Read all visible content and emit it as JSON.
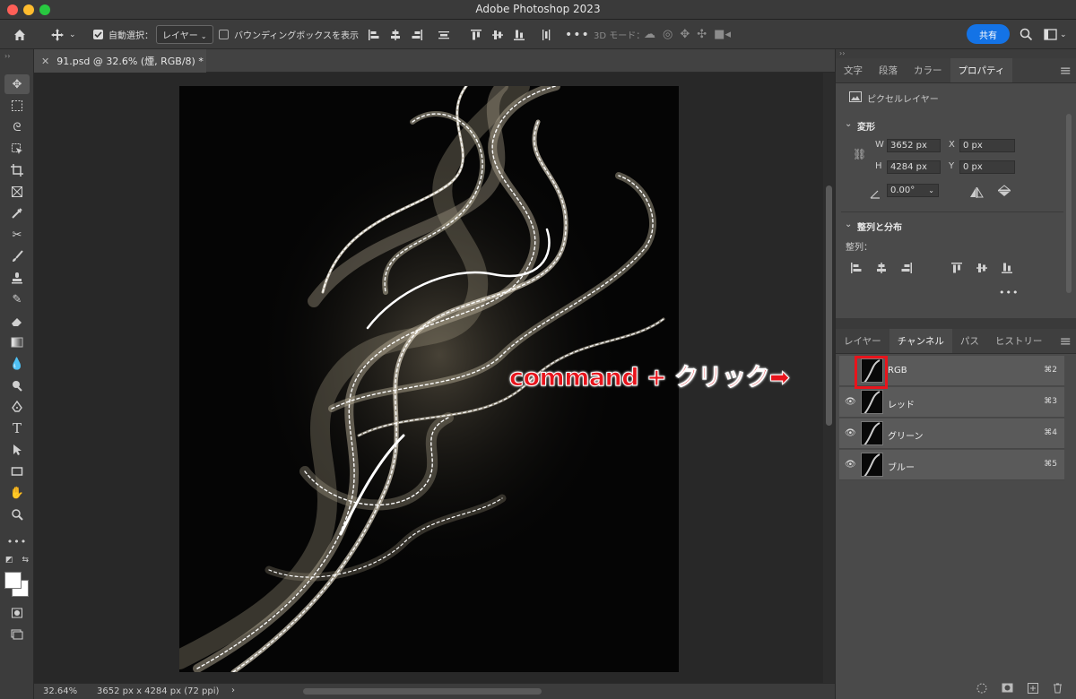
{
  "window": {
    "title": "Adobe Photoshop 2023"
  },
  "options_bar": {
    "auto_select_label": "自動選択：",
    "auto_select_value": "レイヤー",
    "bounding_box_label": "バウンディングボックスを表示",
    "mode_3d_label": "3D モード：",
    "share_label": "共有"
  },
  "document": {
    "tab_title": "91.psd @ 32.6% (煙, RGB/8) *"
  },
  "status_bar": {
    "zoom": "32.64%",
    "doc_info": "3652 px x 4284 px (72 ppi)"
  },
  "top_panel": {
    "tabs": [
      "文字",
      "段落",
      "カラー",
      "プロパティ"
    ],
    "active_tab": 3,
    "layer_kind": "ピクセルレイヤー",
    "transform_section": "変形",
    "w_label": "W",
    "w_value": "3652 px",
    "h_label": "H",
    "h_value": "4284 px",
    "x_label": "X",
    "x_value": "0 px",
    "y_label": "Y",
    "y_value": "0 px",
    "angle_value": "0.00°",
    "align_section": "整列と分布",
    "align_label": "整列："
  },
  "bottom_panel": {
    "tabs": [
      "レイヤー",
      "チャンネル",
      "パス",
      "ヒストリー"
    ],
    "active_tab": 1,
    "channels": [
      {
        "name": "RGB",
        "shortcut": "⌘2"
      },
      {
        "name": "レッド",
        "shortcut": "⌘3"
      },
      {
        "name": "グリーン",
        "shortcut": "⌘4"
      },
      {
        "name": "ブルー",
        "shortcut": "⌘5"
      }
    ]
  },
  "annotation": {
    "callout_text": "command + クリック➡",
    "color": "#e8141c"
  },
  "colors": {
    "accent": "#1473e6",
    "annotation_red": "#e8141c"
  }
}
